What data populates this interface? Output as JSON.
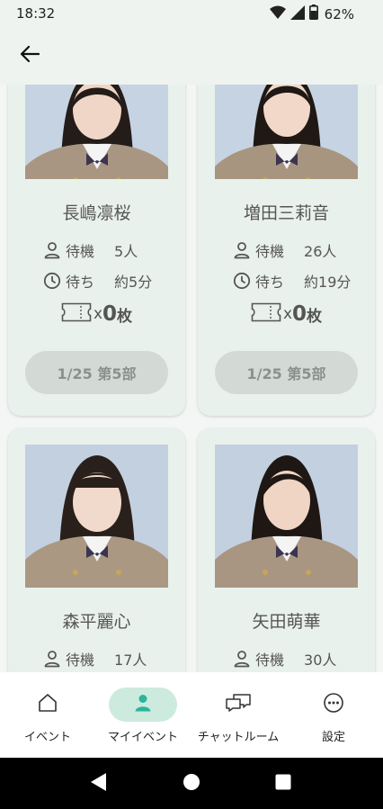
{
  "status_bar": {
    "time": "18:32",
    "battery": "62%"
  },
  "app_bar": {
    "back_icon": "arrow-left-icon"
  },
  "cards": [
    {
      "name": "長嶋凛桜",
      "wait_label": "待機",
      "wait_value": "5人",
      "time_label": "待ち",
      "time_value": "約5分",
      "ticket_x": "x",
      "ticket_count": "0",
      "ticket_unit": "枚",
      "slot_label": "1/25 第5部"
    },
    {
      "name": "増田三莉音",
      "wait_label": "待機",
      "wait_value": "26人",
      "time_label": "待ち",
      "time_value": "約19分",
      "ticket_x": "x",
      "ticket_count": "0",
      "ticket_unit": "枚",
      "slot_label": "1/25 第5部"
    },
    {
      "name": "森平麗心",
      "wait_label": "待機",
      "wait_value": "17人"
    },
    {
      "name": "矢田萌華",
      "wait_label": "待機",
      "wait_value": "30人"
    }
  ],
  "bottom_nav": {
    "items": [
      {
        "label": "イベント",
        "icon": "home-icon",
        "active": false
      },
      {
        "label": "マイイベント",
        "icon": "person-icon",
        "active": true
      },
      {
        "label": "チャットルーム",
        "icon": "chat-icon",
        "active": false
      },
      {
        "label": "設定",
        "icon": "more-icon",
        "active": false
      }
    ]
  },
  "colors": {
    "background": "#eef3ef",
    "card": "#e9f1ec",
    "accent": "#2bb59b",
    "active_pill": "#cdeade",
    "disabled_button": "#d3dad6"
  }
}
